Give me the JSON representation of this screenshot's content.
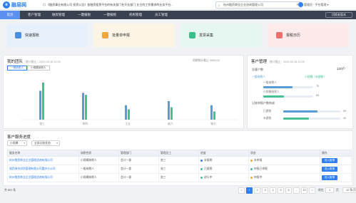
{
  "header": {
    "logo_text": "融易网",
    "notice": "◎ 《融资事业有限公司 投资公告》各融资租赁平台的有关部门在开业部门 业主的工作需求的业务平台...",
    "company_select": "杭州融资商业企业咨询管理公司",
    "user": "管理员 · 平台管理 ▾"
  },
  "nav": {
    "items": [
      "首页",
      "客户管理",
      "融资管理",
      "一键报税",
      "一键报税",
      "机构管理",
      "员工管理"
    ],
    "switch_label": "切换老版本"
  },
  "quick_cards": [
    {
      "label": "快速报账",
      "bg": "#e6f1fb",
      "icon_color": "#4a90e2"
    },
    {
      "label": "批量单申报",
      "bg": "#fcf5e6",
      "icon_color": "#f0a63a"
    },
    {
      "label": "发票采集",
      "bg": "#e6f6f0",
      "icon_color": "#3bbf8a"
    },
    {
      "label": "报税日历",
      "bg": "#fcebea",
      "icon_color": "#ee6d6d"
    }
  ],
  "team": {
    "title": "我的团队",
    "subtitle": "统计截止：2020-03-18 11:00",
    "right_note": "同期统计截止 2020-03",
    "tabs": [
      "一般纳税人",
      "小规模纳税人"
    ],
    "chart_data": {
      "type": "bar",
      "categories": [
        "张三",
        "李四",
        "王五",
        "赵六",
        "钱七"
      ],
      "series": [
        {
          "values": [
            14,
            13,
            7,
            9,
            7
          ],
          "color": "#5a9bd4"
        },
        {
          "values": [
            18,
            12,
            5,
            6,
            4
          ],
          "color": "#43c28f"
        }
      ],
      "ylim": [
        0,
        20
      ]
    },
    "axis_labels": [
      "张三",
      "李四",
      "王五",
      "赵六",
      "钱七"
    ]
  },
  "customer": {
    "title": "客户管理",
    "subtitle": "统计截止：2020-03-18 11:00",
    "total_label": "总客户数",
    "total_value": "120",
    "unit": "户",
    "legend_a": "一般纳税人",
    "legend_b": "小规模（未建账）",
    "rows": [
      {
        "label": "一般纳税人",
        "value": "70",
        "pct": 0.58
      },
      {
        "label": "小规模纳税人",
        "value": "50",
        "pct": 0.42
      }
    ],
    "record_title": "记账申报户数构成",
    "record_rows": [
      {
        "label": "已建账",
        "value": "50",
        "pct": 0.6
      },
      {
        "label": "未建账",
        "value": "40",
        "pct": 0.45
      }
    ]
  },
  "service": {
    "title": "客户服务进度",
    "filters": [
      "小规模",
      "全部记账状态"
    ],
    "columns": [
      "服务名称",
      "纳税性质",
      "管理部门",
      "管理员工",
      "进度",
      "状态",
      "操作"
    ],
    "rows": [
      {
        "name": "杭州融资商业企业管理咨询有限公司",
        "type": "小规模纳税人",
        "dept": "会计一部",
        "staff": "张三",
        "progress": "未报税",
        "progress_color": "#2f7ff0",
        "status": "未申报",
        "status_color": "#f0a63a",
        "op": "进入账簿"
      },
      {
        "name": "湖西城市消防管理有限公司重庆分公司",
        "type": "一般纳税人",
        "dept": "会计一部",
        "staff": "张三",
        "progress": "已报税",
        "progress_color": "#43c28f",
        "status": "申报已申报",
        "status_color": "#43c28f",
        "op": "进入账簿"
      },
      {
        "name": "杭州融资商业企业管理咨询有限公司",
        "type": "小规模纳税人",
        "dept": "会计一部",
        "staff": "张三",
        "progress": "进行中",
        "progress_color": "#43c28f",
        "status": "申报中",
        "status_color": "#f0a63a",
        "op": "进入账簿"
      }
    ]
  },
  "pagination": {
    "total": "共 800 条",
    "pages": [
      "1",
      "2",
      "3",
      "4",
      "5",
      "6",
      "…",
      "10"
    ],
    "prev": "<",
    "next": ">",
    "goto_label": "前往",
    "goto_value": "1",
    "page_unit": "页",
    "page_size": "10 条/页"
  }
}
